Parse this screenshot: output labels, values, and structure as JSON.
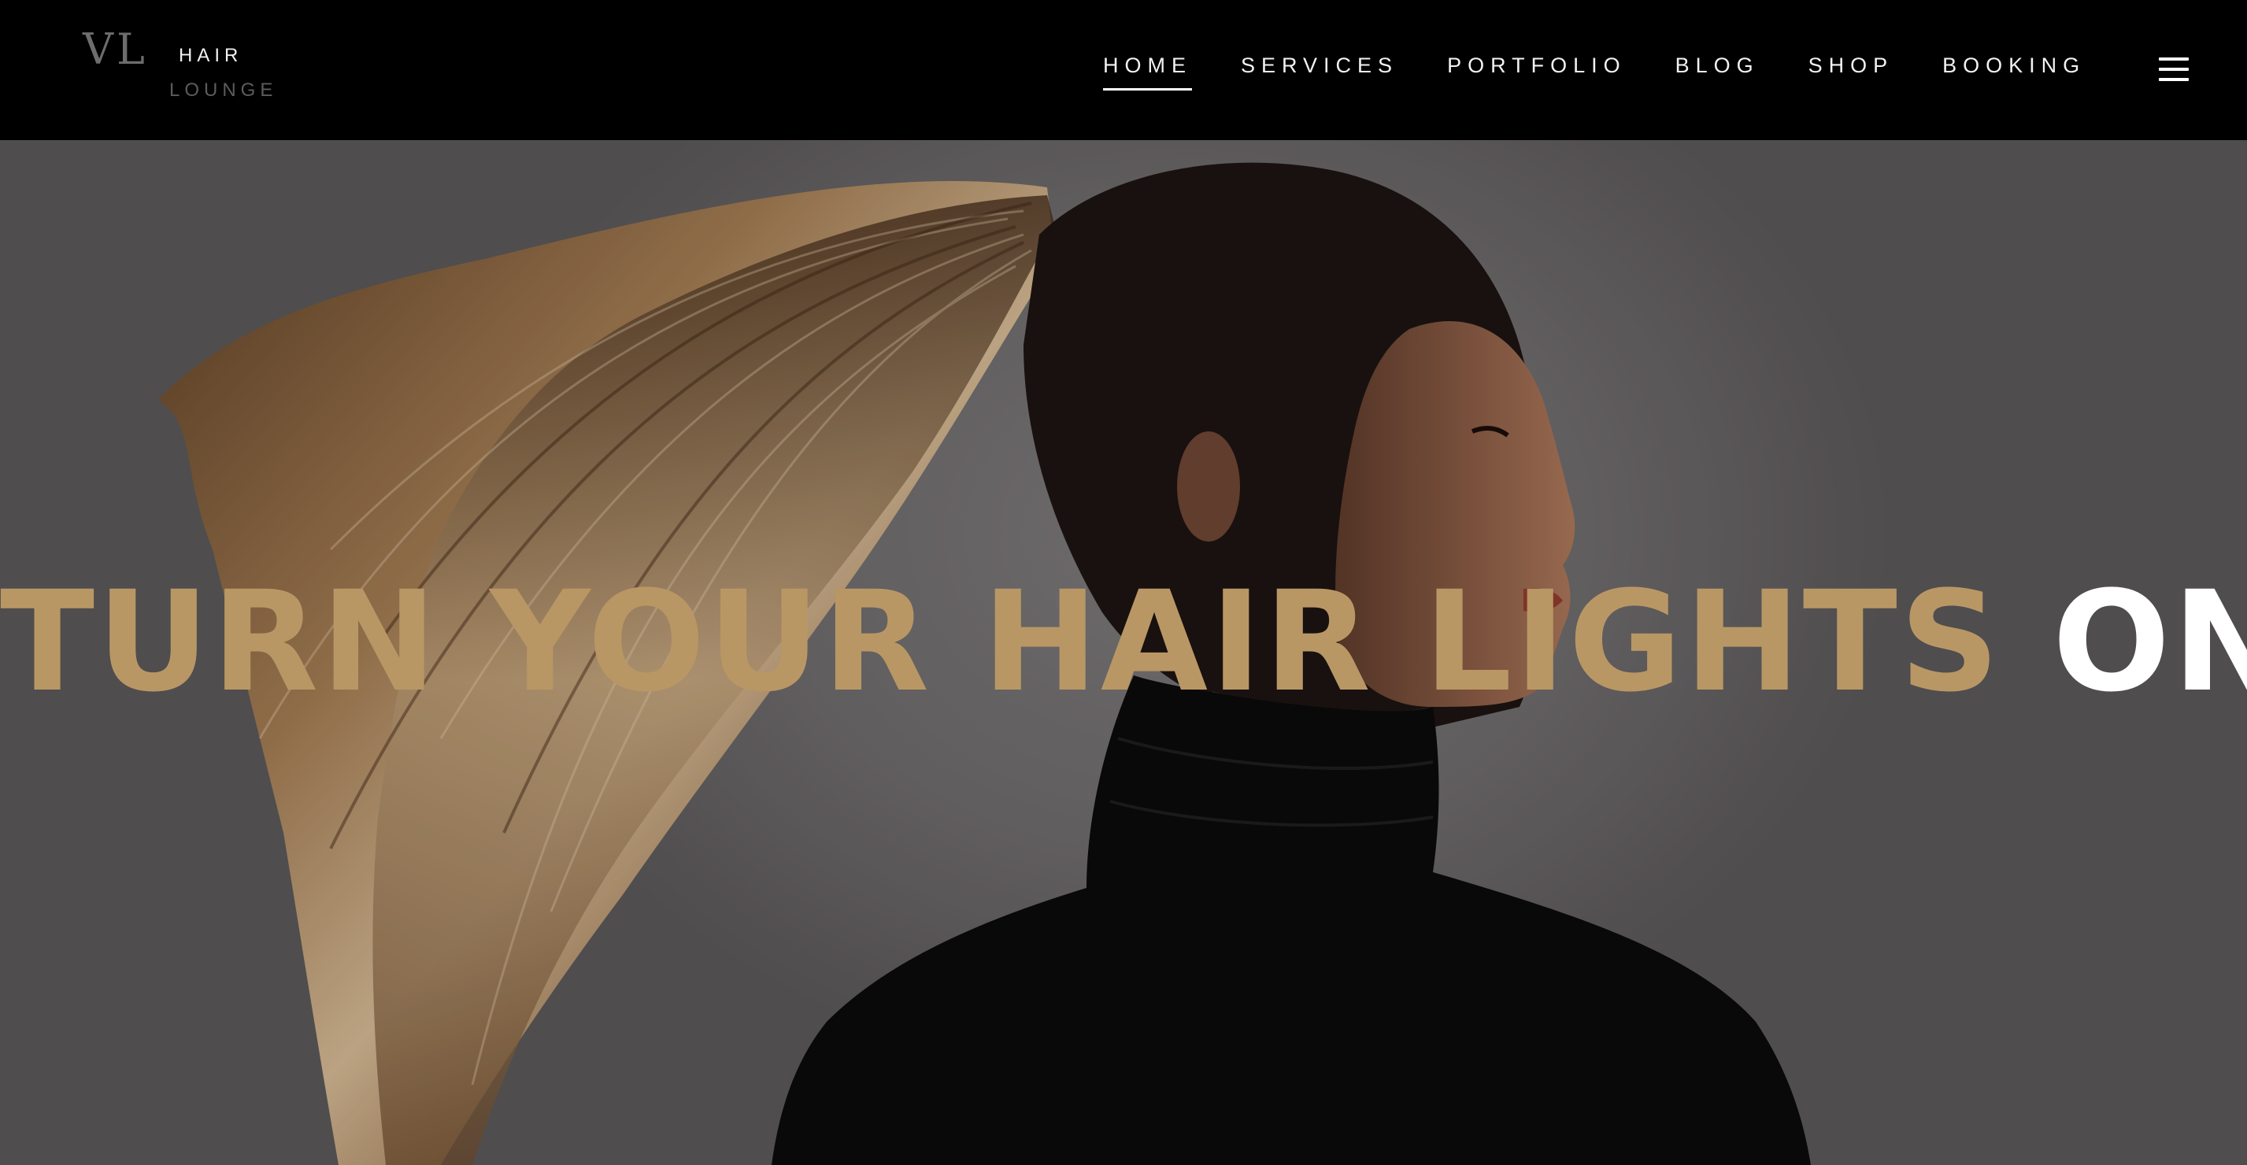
{
  "brand": {
    "mark": "VL",
    "line1": "HAIR",
    "line2": "LOUNGE"
  },
  "nav": {
    "items": [
      {
        "label": "HOME",
        "active": true
      },
      {
        "label": "SERVICES",
        "active": false
      },
      {
        "label": "PORTFOLIO",
        "active": false
      },
      {
        "label": "BLOG",
        "active": false
      },
      {
        "label": "SHOP",
        "active": false
      },
      {
        "label": "BOOKING",
        "active": false
      }
    ],
    "menu_icon": "hamburger-menu-icon"
  },
  "hero": {
    "headline_part1": "TURN YOUR HAIR LIGHTS",
    "headline_part2": "ON",
    "image_subject": "woman-ponytail-profile-photo"
  },
  "colors": {
    "header_bg": "#000000",
    "accent_gold": "#b99765",
    "headline_white": "#ffffff",
    "hero_bg": "#6f6c6d"
  }
}
